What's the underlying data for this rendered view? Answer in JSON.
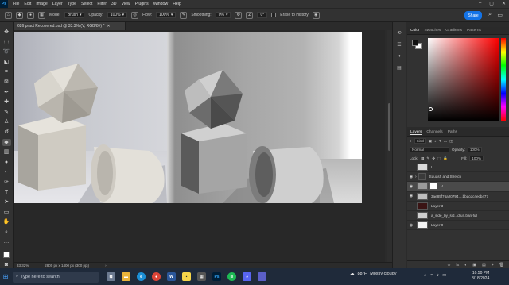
{
  "app": {
    "logo": "Ps",
    "menu": [
      "File",
      "Edit",
      "Image",
      "Layer",
      "Type",
      "Select",
      "Filter",
      "3D",
      "View",
      "Plugins",
      "Window",
      "Help"
    ],
    "window_controls": [
      "–",
      "▢",
      "✕"
    ]
  },
  "options": {
    "mode_label": "Mode:",
    "mode_value": "Brush",
    "opacity_label": "Opacity:",
    "opacity_value": "100%",
    "flow_label": "Flow:",
    "flow_value": "100%",
    "smoothing_label": "Smoothing:",
    "smoothing_value": "0%",
    "angle_value": "0°",
    "erase_history_label": "Erase to History",
    "share_label": "Share"
  },
  "document": {
    "tab_title": "626 pract Recovered.psd @ 33.3% (V, RGB/8#) *",
    "close": "✕"
  },
  "status": {
    "zoom": "33.32%",
    "dimensions": "2800 px x 1400 px (300 ppi)",
    "arrow": "›"
  },
  "color_panel": {
    "tabs": [
      "Color",
      "Swatches",
      "Gradients",
      "Patterns"
    ]
  },
  "layers_panel": {
    "tabs": [
      "Layers",
      "Channels",
      "Paths"
    ],
    "kind_label": "Kind",
    "blend_mode": "Normal",
    "opacity_label": "Opacity:",
    "opacity_value": "100%",
    "lock_label": "Lock:",
    "fill_label": "Fill:",
    "fill_value": "100%",
    "layers": [
      {
        "name": "L",
        "visible": false,
        "selected": false,
        "thumb": "#d9d9d9"
      },
      {
        "name": "Squash and Stretch",
        "visible": true,
        "selected": false,
        "thumb": "#3a3a3a"
      },
      {
        "name": "V",
        "visible": true,
        "selected": true,
        "thumb": "#9a9a9a"
      },
      {
        "name": "3ae85f76a20794....bbacdc4ecb477",
        "visible": true,
        "selected": false,
        "thumb": "#bdbdbd"
      },
      {
        "name": "Layer 3",
        "visible": false,
        "selected": false,
        "thumb": "#3a1414"
      },
      {
        "name": "a_side_by_sid...dfun.ban-full",
        "visible": false,
        "selected": false,
        "thumb": "#cfcfcf"
      },
      {
        "name": "Layer 0",
        "visible": true,
        "selected": false,
        "thumb": "#f2f2f2"
      }
    ],
    "footer_icons": [
      "fx",
      "◐",
      "▣",
      "▤",
      "+",
      "🗑"
    ]
  },
  "taskbar": {
    "search_placeholder": "Type here to search",
    "weather_temp": "88°F",
    "weather_desc": "Mostly cloudy",
    "time": "10:50 PM",
    "date": "8/18/2024"
  }
}
